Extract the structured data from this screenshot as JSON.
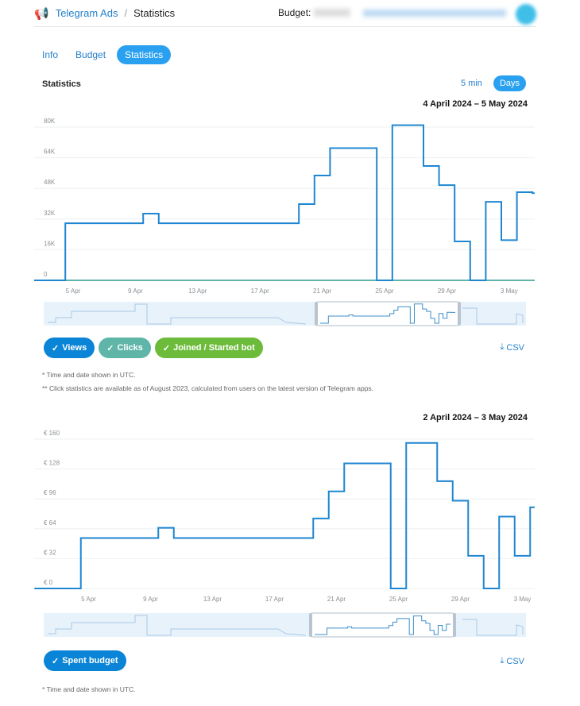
{
  "header": {
    "app": "Telegram Ads",
    "separator": "/",
    "page": "Statistics",
    "budget_label": "Budget:",
    "logo_icon": "megaphone-icon"
  },
  "tabs": [
    {
      "label": "Info"
    },
    {
      "label": "Budget"
    },
    {
      "label": "Statistics",
      "active": true
    }
  ],
  "section_title": "Statistics",
  "granularity": [
    {
      "label": "5 min"
    },
    {
      "label": "Days",
      "active": true
    }
  ],
  "colors": {
    "accent": "#2481cc",
    "views": "#1f86d1",
    "clicks": "#5fb5a8",
    "joined": "#6dbb3a",
    "spent": "#1f86d1"
  },
  "csv_label": "CSV",
  "notes": {
    "utc": "* Time and date shown in UTC.",
    "clicks": "** Click statistics are available as of August 2023, calculated from users on the latest version of Telegram apps."
  },
  "chart_data": [
    {
      "type": "line",
      "step": true,
      "range_label": "4 April 2024 – 5 May 2024",
      "xlim": [
        "2024-04-03",
        "2024-05-05"
      ],
      "ylim": [
        0,
        80000
      ],
      "yticks": [
        "0",
        "16K",
        "32K",
        "48K",
        "64K",
        "80K"
      ],
      "ytick_values": [
        0,
        16000,
        32000,
        48000,
        64000,
        80000
      ],
      "xticks": [
        "5 Apr",
        "9 Apr",
        "13 Apr",
        "17 Apr",
        "21 Apr",
        "25 Apr",
        "29 Apr",
        "3 May"
      ],
      "grid": true,
      "x": [
        "3 Apr",
        "4 Apr",
        "5 Apr",
        "6 Apr",
        "7 Apr",
        "8 Apr",
        "9 Apr",
        "10 Apr",
        "11 Apr",
        "12 Apr",
        "13 Apr",
        "14 Apr",
        "15 Apr",
        "16 Apr",
        "17 Apr",
        "18 Apr",
        "19 Apr",
        "20 Apr",
        "21 Apr",
        "22 Apr",
        "23 Apr",
        "24 Apr",
        "25 Apr",
        "26 Apr",
        "27 Apr",
        "28 Apr",
        "29 Apr",
        "30 Apr",
        "1 May",
        "2 May",
        "3 May",
        "4 May",
        "5 May"
      ],
      "series": [
        {
          "name": "Views",
          "color": "#1f86d1",
          "values": [
            0,
            0,
            29800,
            29800,
            29800,
            29800,
            29800,
            34800,
            29800,
            29800,
            29800,
            29800,
            29800,
            29800,
            29800,
            29800,
            29800,
            39800,
            54700,
            69000,
            69000,
            69000,
            0,
            81000,
            81000,
            59700,
            49700,
            20300,
            0,
            41000,
            21000,
            46000,
            45500
          ]
        },
        {
          "name": "Clicks",
          "color": "#5fb5a8",
          "values": [
            0,
            0,
            0,
            0,
            0,
            0,
            0,
            0,
            0,
            0,
            0,
            0,
            0,
            0,
            0,
            0,
            0,
            0,
            0,
            0,
            0,
            0,
            0,
            0,
            0,
            0,
            0,
            0,
            0,
            0,
            0,
            0,
            0
          ]
        },
        {
          "name": "Joined / Started bot",
          "color": "#6dbb3a",
          "values": [
            0,
            0,
            0,
            0,
            0,
            0,
            0,
            0,
            0,
            0,
            0,
            0,
            0,
            0,
            0,
            0,
            0,
            0,
            0,
            0,
            0,
            0,
            0,
            0,
            0,
            0,
            0,
            0,
            0,
            0,
            0,
            0,
            0
          ]
        }
      ]
    },
    {
      "type": "line",
      "step": true,
      "range_label": "2 April 2024 – 3 May 2024",
      "xlim": [
        "2024-04-02",
        "2024-05-04"
      ],
      "ylim": [
        0,
        160
      ],
      "yticks": [
        "€ 0",
        "€ 32",
        "€ 64",
        "€ 96",
        "€ 128",
        "€ 160"
      ],
      "ytick_values": [
        0,
        32,
        64,
        96,
        128,
        160
      ],
      "xticks": [
        "5 Apr",
        "9 Apr",
        "13 Apr",
        "17 Apr",
        "21 Apr",
        "25 Apr",
        "29 Apr",
        "3 May"
      ],
      "grid": true,
      "x": [
        "2 Apr",
        "3 Apr",
        "4 Apr",
        "5 Apr",
        "6 Apr",
        "7 Apr",
        "8 Apr",
        "9 Apr",
        "10 Apr",
        "11 Apr",
        "12 Apr",
        "13 Apr",
        "14 Apr",
        "15 Apr",
        "16 Apr",
        "17 Apr",
        "18 Apr",
        "19 Apr",
        "20 Apr",
        "21 Apr",
        "22 Apr",
        "23 Apr",
        "24 Apr",
        "25 Apr",
        "26 Apr",
        "27 Apr",
        "28 Apr",
        "29 Apr",
        "30 Apr",
        "1 May",
        "2 May",
        "3 May",
        "4 May"
      ],
      "series": [
        {
          "name": "Spent budget",
          "color": "#1f86d1",
          "values": [
            0,
            0,
            0,
            54,
            54,
            54,
            54,
            54,
            65,
            54,
            54,
            54,
            54,
            54,
            54,
            54,
            54,
            54,
            75,
            104,
            134,
            134,
            134,
            0,
            156,
            156,
            115,
            94,
            35,
            0,
            77,
            35,
            87
          ]
        }
      ]
    }
  ]
}
